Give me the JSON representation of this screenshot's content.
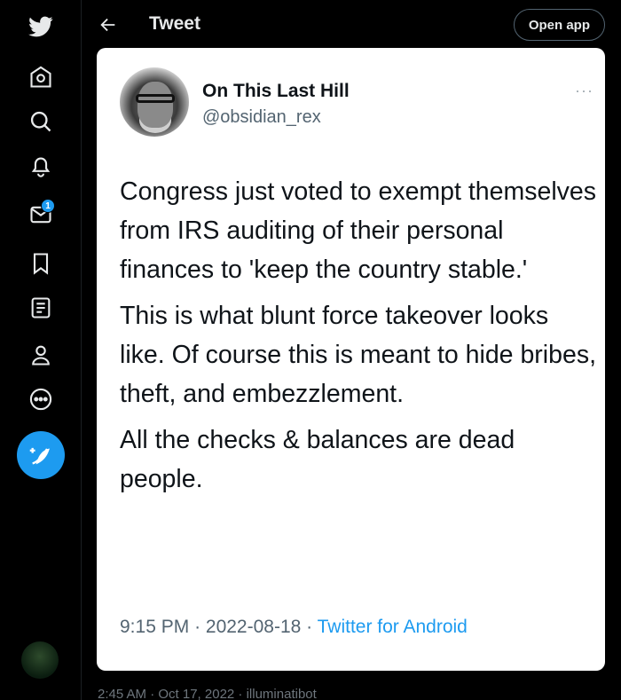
{
  "nav": {
    "notifications_badge": "1",
    "accent": "#1d9bf0"
  },
  "header": {
    "title": "Tweet",
    "open_app_label": "Open app"
  },
  "tweet": {
    "display_name": "On This Last Hill",
    "handle": "@obsidian_rex",
    "more": "···",
    "paragraphs": [
      "Congress just voted to exempt themselves from IRS auditing of their personal finances to 'keep the country stable.'",
      "This is what blunt force takeover looks like. Of course this is meant to hide bribes, theft, and embezzlement.",
      "All the checks & balances are dead people."
    ],
    "time": "9:15 PM",
    "date": "2022-08-18",
    "source": "Twitter for Android"
  },
  "footer": {
    "text": "2:45 AM · Oct 17, 2022 · illuminatibot"
  }
}
